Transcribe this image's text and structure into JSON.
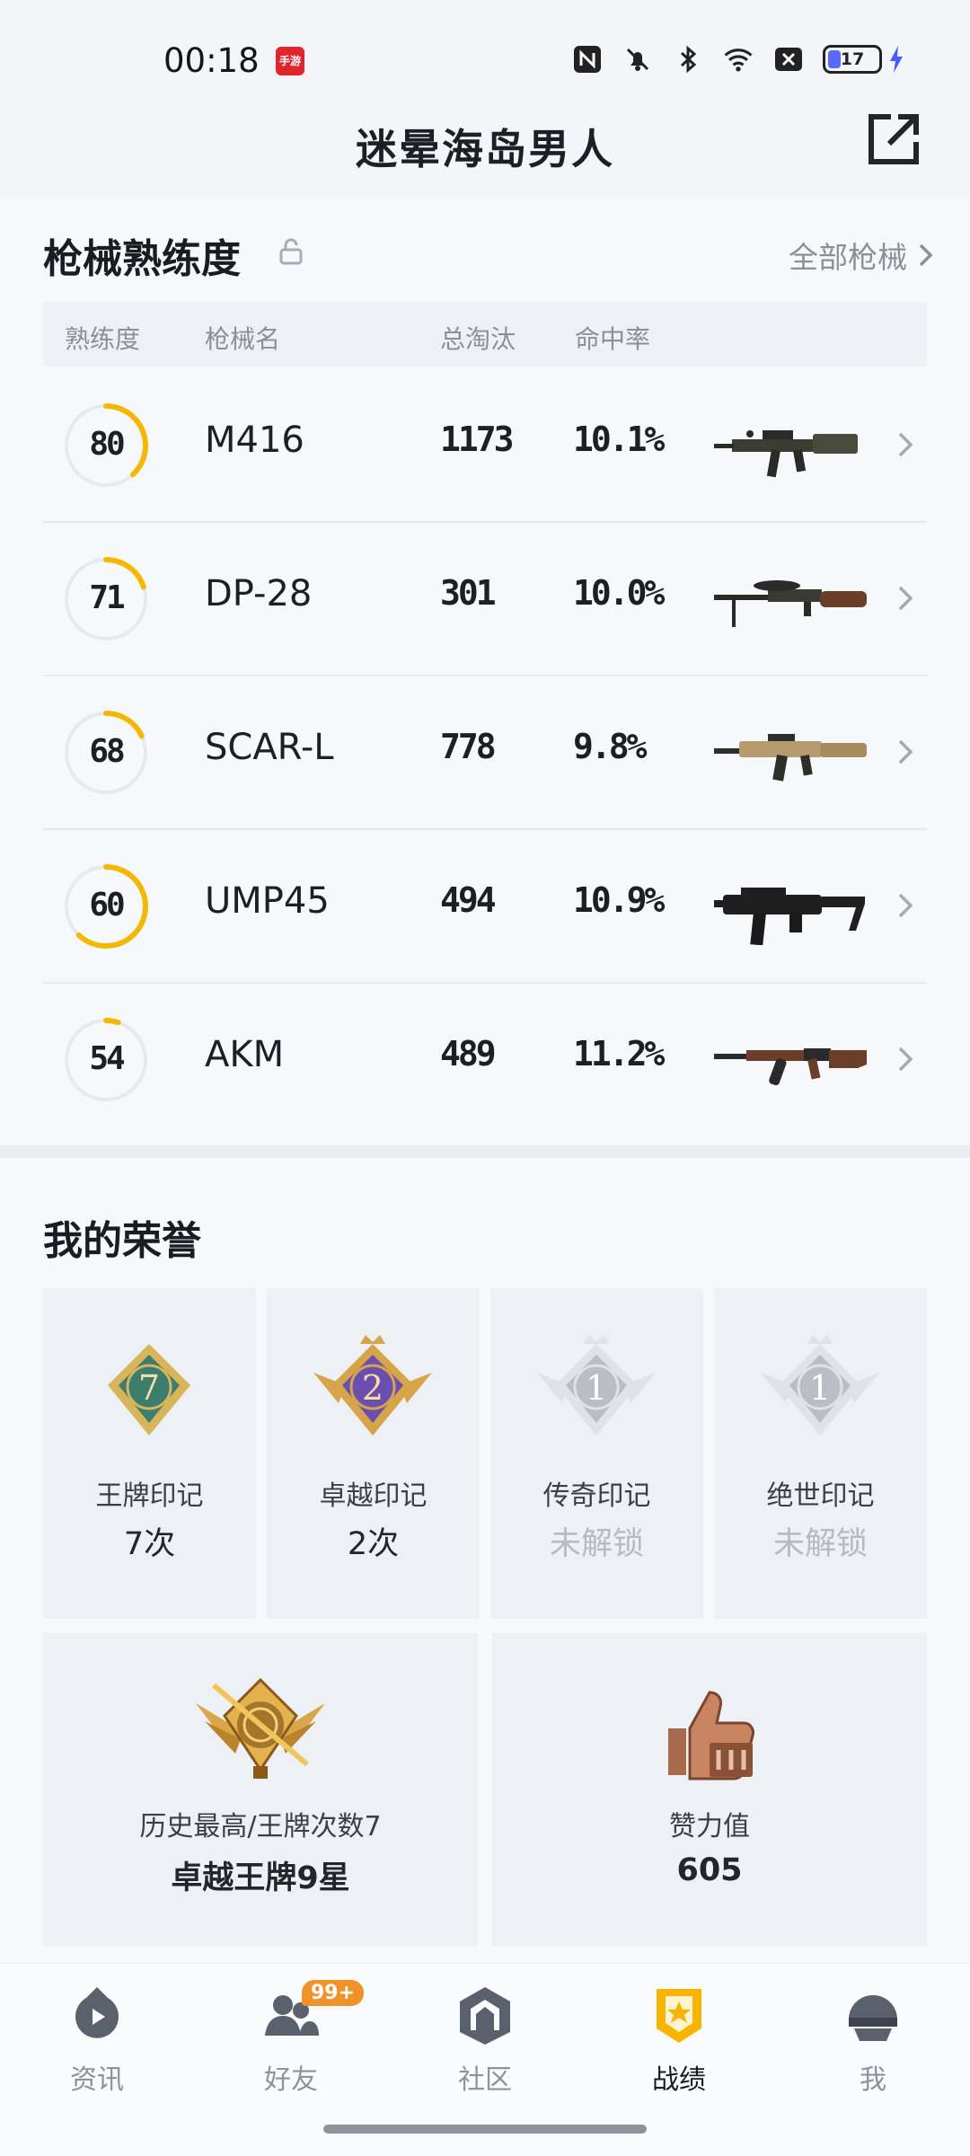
{
  "status": {
    "time": "00:18",
    "app_badge": "手游",
    "battery": "17"
  },
  "header": {
    "title": "迷晕海岛男人"
  },
  "weapons": {
    "title": "枪械熟练度",
    "all_link": "全部枪械",
    "columns": [
      "熟练度",
      "枪械名",
      "总淘汰",
      "命中率"
    ],
    "rows": [
      {
        "level": "80",
        "name": "M416",
        "kills": "1173",
        "hit": "10.1%",
        "progress": 0.38,
        "gun": "m416"
      },
      {
        "level": "71",
        "name": "DP-28",
        "kills": "301",
        "hit": "10.0%",
        "progress": 0.2,
        "gun": "dp28"
      },
      {
        "level": "68",
        "name": "SCAR-L",
        "kills": "778",
        "hit": "9.8%",
        "progress": 0.18,
        "gun": "scar"
      },
      {
        "level": "60",
        "name": "UMP45",
        "kills": "494",
        "hit": "10.9%",
        "progress": 0.62,
        "gun": "ump"
      },
      {
        "level": "54",
        "name": "AKM",
        "kills": "489",
        "hit": "11.2%",
        "progress": 0.05,
        "gun": "akm"
      }
    ]
  },
  "honors": {
    "title": "我的荣誉",
    "badges": [
      {
        "label": "王牌印记",
        "value": "7次",
        "icon": "ace-emblem-icon",
        "num": "7",
        "locked": false
      },
      {
        "label": "卓越印记",
        "value": "2次",
        "icon": "excellence-emblem-icon",
        "num": "2",
        "locked": false
      },
      {
        "label": "传奇印记",
        "value": "未解锁",
        "icon": "legend-emblem-icon",
        "num": "1",
        "locked": true
      },
      {
        "label": "绝世印记",
        "value": "未解锁",
        "icon": "peerless-emblem-icon",
        "num": "1",
        "locked": true
      }
    ],
    "best": {
      "label": "历史最高/王牌次数7",
      "value": "卓越王牌9星"
    },
    "likes": {
      "label": "赞力值",
      "value": "605"
    }
  },
  "nav": {
    "items": [
      {
        "label": "资讯",
        "icon": "news-icon"
      },
      {
        "label": "好友",
        "icon": "friends-icon",
        "badge": "99+"
      },
      {
        "label": "社区",
        "icon": "community-icon"
      },
      {
        "label": "战绩",
        "icon": "record-icon",
        "active": true
      },
      {
        "label": "我",
        "icon": "profile-icon"
      }
    ]
  },
  "colors": {
    "accent": "#f5b800",
    "text": "#1c1f26",
    "muted": "#8a8f99"
  }
}
